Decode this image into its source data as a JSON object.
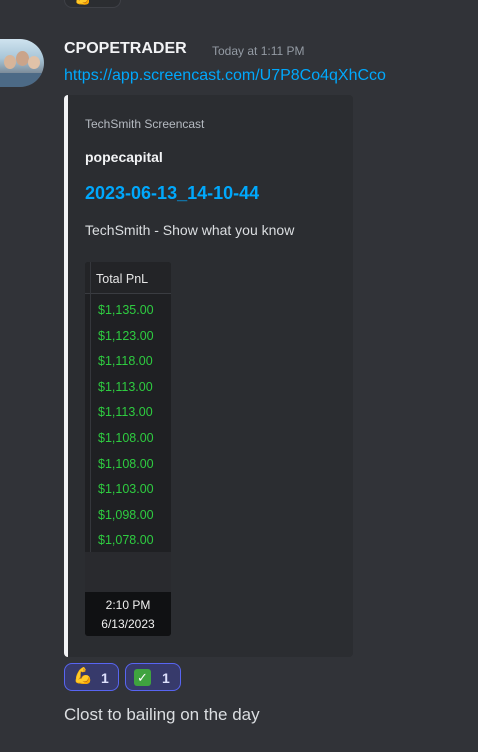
{
  "top_reaction": {
    "emoji": "💪"
  },
  "message": {
    "username": "CPOPETRADER",
    "timestamp": "Today at 1:11 PM",
    "link": "https://app.screencast.com/U7P8Co4qXhCco",
    "embed": {
      "provider": "TechSmith Screencast",
      "author": "popecapital",
      "title": "2023-06-13_14-10-44",
      "description": "TechSmith - Show what you know",
      "thumbnail": {
        "header": "Total PnL",
        "values": [
          "$1,135.00",
          "$1,123.00",
          "$1,118.00",
          "$1,113.00",
          "$1,113.00",
          "$1,108.00",
          "$1,108.00",
          "$1,103.00",
          "$1,098.00",
          "$1,078.00"
        ],
        "time": "2:10 PM",
        "date": "6/13/2023"
      }
    },
    "reactions": [
      {
        "emoji": "💪",
        "count": "1"
      },
      {
        "emoji": "✓",
        "count": "1"
      }
    ],
    "text": "Clost to bailing on the day"
  },
  "colors": {
    "background": "#313338",
    "link": "#00a8fc",
    "embed_bg": "#2b2d31",
    "pnl_green": "#2ecc40",
    "reaction_bg": "#373a6b",
    "reaction_border": "#5865f2"
  }
}
